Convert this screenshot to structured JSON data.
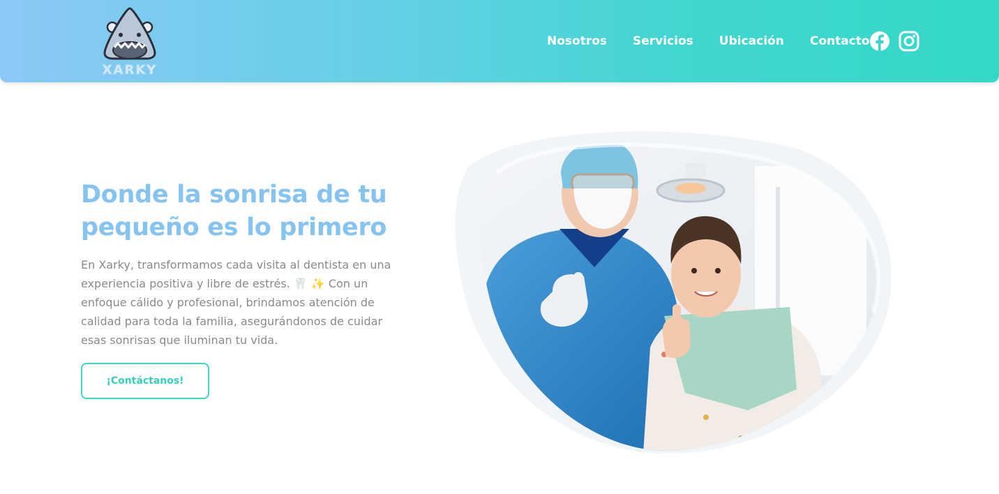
{
  "brand": {
    "name": "XARKY"
  },
  "nav": {
    "items": [
      {
        "label": "Nosotros"
      },
      {
        "label": "Servicios"
      },
      {
        "label": "Ubicación"
      },
      {
        "label": "Contacto"
      }
    ],
    "social": [
      {
        "icon": "facebook-icon"
      },
      {
        "icon": "instagram-icon"
      }
    ]
  },
  "hero": {
    "title_line1": "Donde la sonrisa de tu",
    "title_line2": "pequeño es lo primero",
    "description": "En Xarky, transformamos cada visita al dentista en una experiencia positiva y libre de estrés. 🦷 ✨ Con un enfoque cálido y profesional, brindamos atención de calidad para toda la familia, asegurándonos de cuidar esas sonrisas que iluminan tu vida.",
    "cta_label": "¡Contáctanos!",
    "image": "dentist-with-girl-photo"
  },
  "colors": {
    "header_gradient_start": "#8cc8f6",
    "header_gradient_end": "#34d8c8",
    "title": "#85c4f1",
    "body_text": "#8a8a8a",
    "accent": "#3fd5c8"
  }
}
